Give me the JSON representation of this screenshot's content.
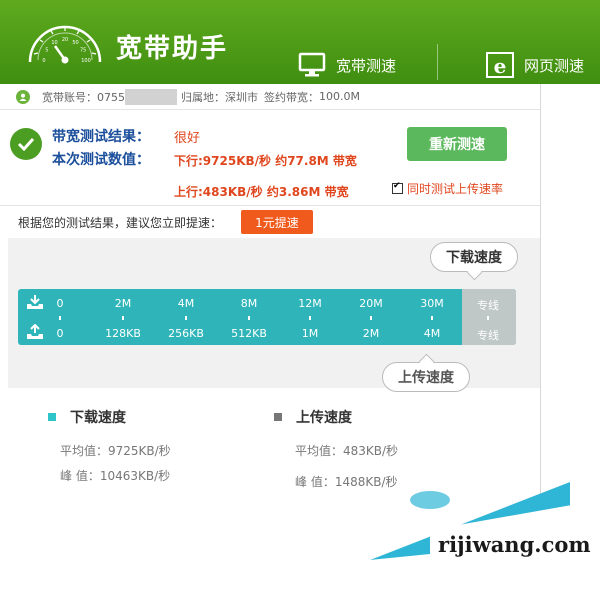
{
  "header": {
    "title": "宽带助手",
    "tabs": [
      {
        "label": "宽带测速",
        "icon": "monitor-icon"
      },
      {
        "label": "网页测速",
        "icon": "ie-browser-icon"
      }
    ],
    "gauge_labels": [
      "0",
      "5",
      "10",
      "20",
      "50",
      "75",
      "100"
    ]
  },
  "account": {
    "account_label": "宽带账号：0755",
    "location_label": "归属地：",
    "location_value": "深圳市",
    "bandwidth_label": "签约带宽：",
    "bandwidth_value": "100.0M"
  },
  "result": {
    "title_label": "带宽测试结果：",
    "rating": "很好",
    "data_label": "本次测试数值：",
    "download_line": "下行:9725KB/秒 约77.8M 带宽",
    "upload_line": "上行:483KB/秒 约3.86M 带宽",
    "retest_label": "重新测速",
    "upload_option_label": "同时测试上传速率",
    "upload_option_checked": true
  },
  "suggest": {
    "text": "根据您的测试结果，建议您立即提速：",
    "button_label": "1元提速"
  },
  "speed_scale": {
    "download_bubble": "下载速度",
    "upload_bubble": "上传速度",
    "download_ticks": [
      "0",
      "2M",
      "4M",
      "8M",
      "12M",
      "20M",
      "30M",
      "专线"
    ],
    "upload_ticks": [
      "0",
      "128KB",
      "256KB",
      "512KB",
      "1M",
      "2M",
      "4M",
      "专线"
    ]
  },
  "stats": {
    "download": {
      "title": "下载速度",
      "avg_label": "平均值：9725KB/秒",
      "peak_label": "峰  值：10463KB/秒",
      "color": "#2ec4c8"
    },
    "upload": {
      "title": "上传速度",
      "avg_label": "平均值：483KB/秒",
      "peak_label": "峰  值：1488KB/秒",
      "color": "#777777"
    }
  },
  "watermark": "rijiwang.com",
  "colors": {
    "header_green": "#4c9e18",
    "accent_orange": "#e0471e",
    "retest_green": "#5cb85c",
    "bar_teal": "#2fb5b9",
    "label_blue": "#1c4f9c"
  }
}
